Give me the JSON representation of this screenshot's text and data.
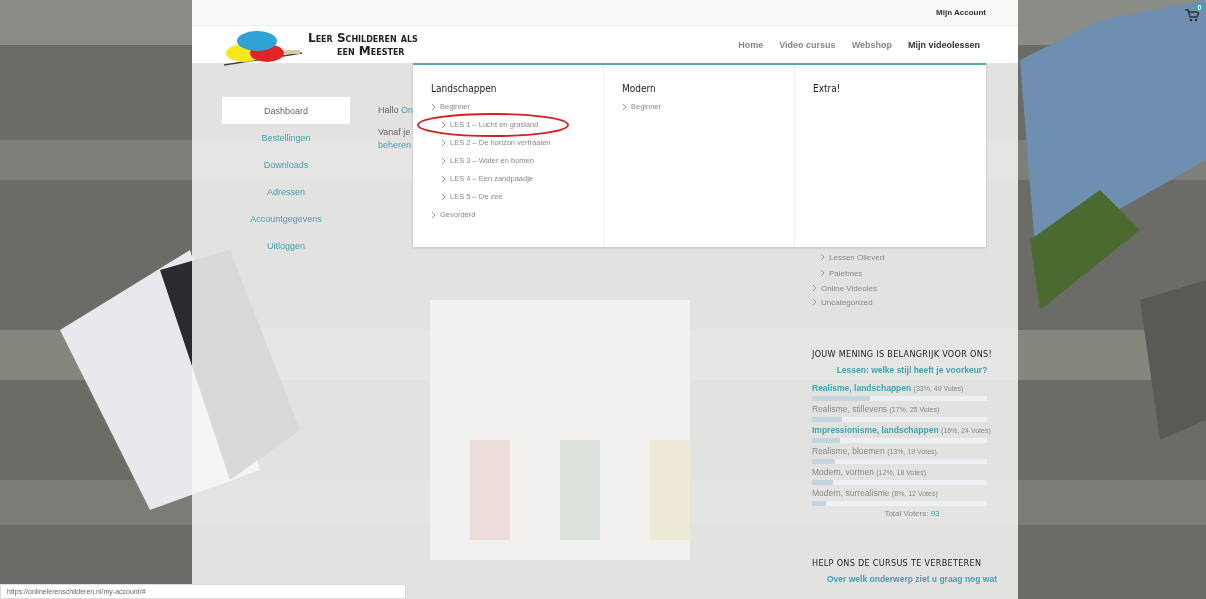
{
  "top_bar": {
    "link": "Mijn Account"
  },
  "logo": {
    "line_1": "Leer Schilderen als",
    "line_2": "een Meester"
  },
  "nav": [
    {
      "label": "Home",
      "selected": false
    },
    {
      "label": "Video cursus",
      "selected": false
    },
    {
      "label": "Webshop",
      "selected": false
    },
    {
      "label": "Mijn videolessen",
      "selected": true
    }
  ],
  "mega_menu": {
    "columns": [
      {
        "title": "Landschappen",
        "items": [
          {
            "label": "Beginner",
            "children": [
              {
                "label": "LES 1 – Lucht en grasland",
                "circled": true
              },
              {
                "label": "LES 2 – De horizon verfraaien",
                "circled": false
              },
              {
                "label": "LES 3 – Water en bomen",
                "circled": false
              },
              {
                "label": "LES 4 – Een zandpaadje",
                "circled": false
              },
              {
                "label": "LES 5 – De zee",
                "circled": false
              }
            ]
          },
          {
            "label": "Gevorderd"
          }
        ]
      },
      {
        "title": "Modern",
        "items": [
          {
            "label": "Beginner"
          }
        ]
      },
      {
        "title": "Extra!"
      }
    ]
  },
  "account_nav": [
    {
      "label": "Dashboard",
      "selected": true
    },
    {
      "label": "Bestellingen",
      "selected": false
    },
    {
      "label": "Downloads",
      "selected": false
    },
    {
      "label": "Adressen",
      "selected": false
    },
    {
      "label": "Accountgegevens",
      "selected": false
    },
    {
      "label": "Uitloggen",
      "selected": false
    }
  ],
  "content": {
    "greeting": "Hallo",
    "greeting_link": "On",
    "intro": "Vanaf je",
    "intro_link": "beheren"
  },
  "categories": [
    {
      "children": [
        {
          "label": "Lessen Olievert"
        },
        {
          "label": "Paletmes"
        }
      ]
    },
    {
      "label": "Online Videoles"
    },
    {
      "label": "Uncategorized"
    }
  ],
  "poll": {
    "heading": "JOUW MENING IS BELANGRIJK VOOR ONS!",
    "question": "Lessen: welke stijl heeft je voorkeur?",
    "answers": [
      {
        "label": "Realisme, landschappen",
        "stats": "(33%, 49 Votes)",
        "highlighted": true,
        "level": 0.33
      },
      {
        "label": "Realisme, stillevens",
        "stats": "(17%, 25 Votes)",
        "highlighted": false,
        "level": 0.17
      },
      {
        "label": "Impressionisme, landschappen",
        "stats": "(16%, 24 Votes)",
        "highlighted": true,
        "level": 0.16
      },
      {
        "label": "Realisme, bloemen",
        "stats": "(13%, 19 Votes)",
        "highlighted": false,
        "level": 0.13
      },
      {
        "label": "Modern, vormen",
        "stats": "(12%, 18 Votes)",
        "highlighted": false,
        "level": 0.12
      },
      {
        "label": "Modern, surrealisme",
        "stats": "(8%, 12 Votes)",
        "highlighted": false,
        "level": 0.08
      }
    ],
    "total_label": "Total Voters:",
    "total": "93"
  },
  "help": {
    "heading": "HELP ONS DE CURSUS TE VERBETEREN",
    "question": "Over welk onderwerp ziet u graag nog wat"
  },
  "cart": {
    "count": "0"
  },
  "status_bar": {
    "url": "https://onlinelerenschilderen.nl/my-account/#"
  }
}
